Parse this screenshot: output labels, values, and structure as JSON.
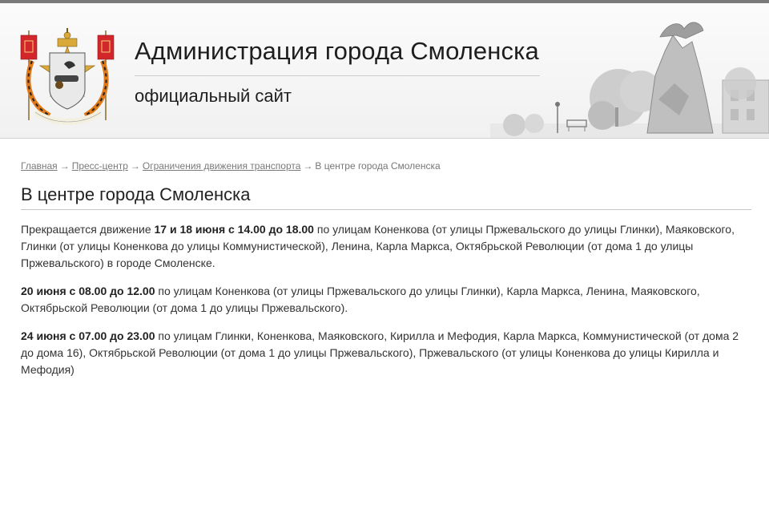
{
  "header": {
    "title": "Администрация города Смоленска",
    "subtitle": "официальный сайт",
    "emblem_icon": "smolensk-coat-of-arms-icon",
    "colors": {
      "red": "#d2262b",
      "gold": "#d9a93a",
      "ribbon_orange": "#e07a1a",
      "ribbon_black": "#222222"
    }
  },
  "breadcrumb": {
    "home": "Главная",
    "press": "Пресс-центр",
    "section": "Ограничения движения транспорта",
    "current": "В центре города Смоленска",
    "separator": "→"
  },
  "page": {
    "title": "В центре города Смоленска"
  },
  "article": {
    "p1": {
      "lead": "Прекращается движение ",
      "bold": "17 и 18 июня с 14.00 до 18.00",
      "rest": " по улицам Коненкова (от улицы Пржевальского до улицы Глинки), Маяковского, Глинки (от улицы Коненкова до улицы Коммунистической), Ленина, Карла Маркса, Октябрьской Революции (от дома 1 до улицы Пржевальского) в городе Смоленске."
    },
    "p2": {
      "bold": "20 июня с 08.00 до 12.00",
      "rest": " по улицам Коненкова (от улицы Пржевальского до улицы Глинки), Карла Маркса, Ленина, Маяковского, Октябрьской Революции (от дома 1 до улицы Пржевальского)."
    },
    "p3": {
      "bold": "24 июня с 07.00 до 23.00",
      "rest": " по улицам Глинки, Коненкова, Маяковского, Кирилла и Мефодия, Карла Маркса, Коммунистической (от дома 2 до дома 16), Октябрьской Революции (от дома 1 до улицы Пржевальского), Пржевальского (от улицы Коненкова до улицы Кирилла и Мефодия)"
    }
  }
}
